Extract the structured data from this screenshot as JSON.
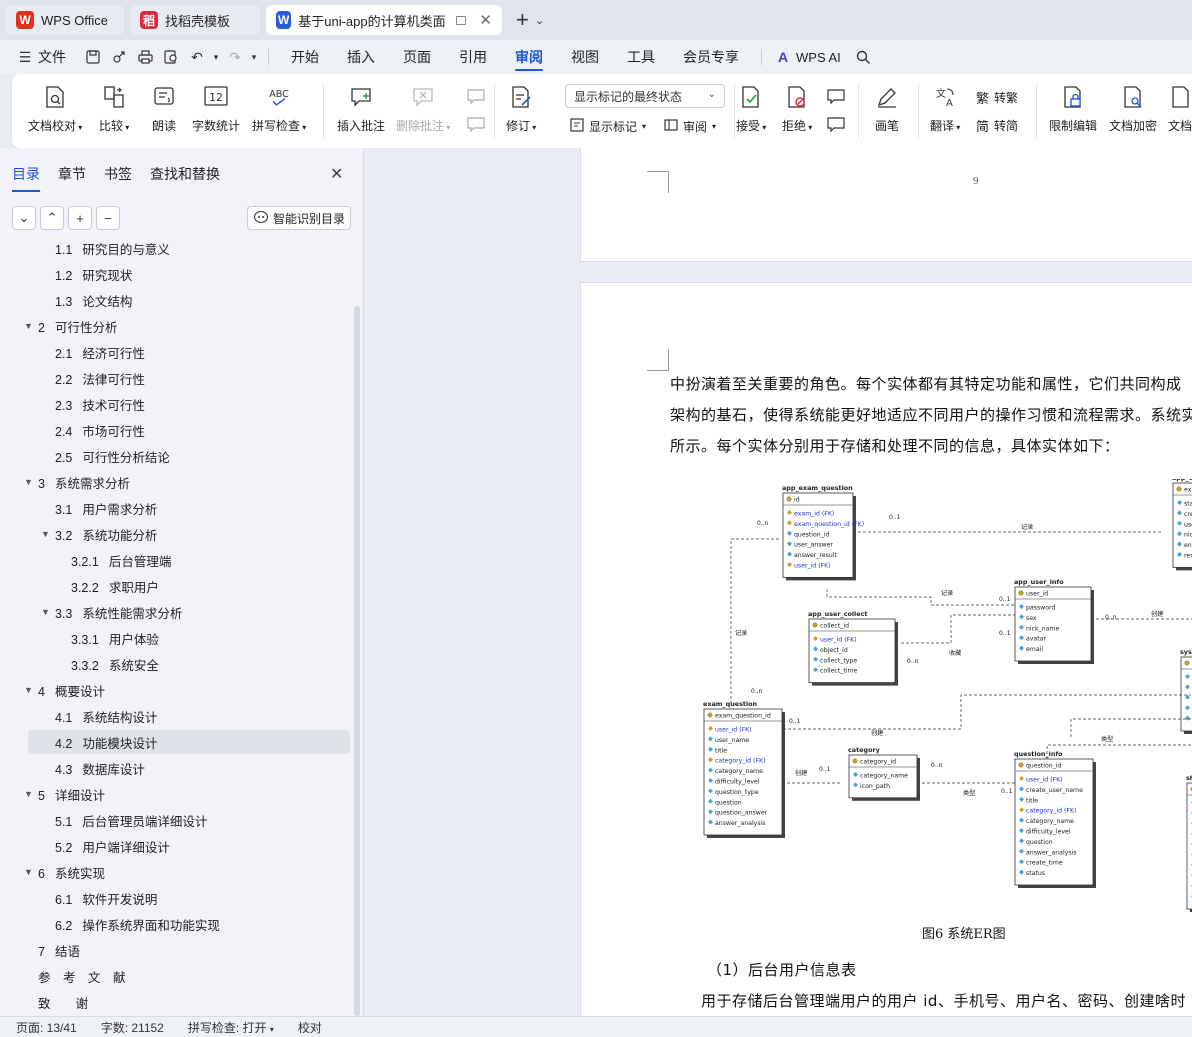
{
  "tabs": [
    {
      "label": "WPS Office",
      "icon": "wps-logo-icon"
    },
    {
      "label": "找稻壳模板",
      "icon": "docer-logo-icon"
    },
    {
      "label": "基于uni-app的计算机类面试王",
      "icon": "word-doc-icon"
    }
  ],
  "menu": {
    "file": "文件",
    "items": [
      "开始",
      "插入",
      "页面",
      "引用",
      "审阅",
      "视图",
      "工具",
      "会员专享"
    ],
    "active": "审阅",
    "wps_ai": "WPS AI"
  },
  "ribbon": {
    "doc_check": "文档校对",
    "compare": "比较",
    "read_aloud": "朗读",
    "word_count": "字数统计",
    "spell_check": "拼写检查",
    "insert_comment": "插入批注",
    "delete_comment": "删除批注",
    "revise": "修订",
    "markup_dropdown": "显示标记的最终状态",
    "show_markup": "显示标记",
    "review": "审阅",
    "accept": "接受",
    "reject": "拒绝",
    "brush": "画笔",
    "translate": "翻译",
    "to_traditional": "转繁",
    "to_simplified": "转简",
    "restrict_edit": "限制编辑",
    "doc_encrypt": "文档加密",
    "doc_more": "文档"
  },
  "panel": {
    "tabs": [
      "目录",
      "章节",
      "书签",
      "查找和替换"
    ],
    "active_tab": "目录",
    "smart_toc": "智能识别目录",
    "toc": [
      {
        "num": "1.1",
        "label": "研究目的与意义",
        "level": 2
      },
      {
        "num": "1.2",
        "label": "研究现状",
        "level": 2
      },
      {
        "num": "1.3",
        "label": "论文结构",
        "level": 2
      },
      {
        "num": "2",
        "label": "可行性分析",
        "level": 1
      },
      {
        "num": "2.1",
        "label": "经济可行性",
        "level": 2
      },
      {
        "num": "2.2",
        "label": "法律可行性",
        "level": 2
      },
      {
        "num": "2.3",
        "label": "技术可行性",
        "level": 2
      },
      {
        "num": "2.4",
        "label": "市场可行性",
        "level": 2
      },
      {
        "num": "2.5",
        "label": "可行性分析结论",
        "level": 2
      },
      {
        "num": "3",
        "label": "系统需求分析",
        "level": 1
      },
      {
        "num": "3.1",
        "label": "用户需求分析",
        "level": 2
      },
      {
        "num": "3.2",
        "label": "系统功能分析",
        "level": 2
      },
      {
        "num": "3.2.1",
        "label": "后台管理端",
        "level": 3
      },
      {
        "num": "3.2.2",
        "label": "求职用户",
        "level": 3
      },
      {
        "num": "3.3",
        "label": "系统性能需求分析",
        "level": 2
      },
      {
        "num": "3.3.1",
        "label": "用户体验",
        "level": 3
      },
      {
        "num": "3.3.2",
        "label": "系统安全",
        "level": 3
      },
      {
        "num": "4",
        "label": "概要设计",
        "level": 1
      },
      {
        "num": "4.1",
        "label": "系统结构设计",
        "level": 2
      },
      {
        "num": "4.2",
        "label": "功能模块设计",
        "level": 2
      },
      {
        "num": "4.3",
        "label": "数据库设计",
        "level": 2
      },
      {
        "num": "5",
        "label": "详细设计",
        "level": 1
      },
      {
        "num": "5.1",
        "label": "后台管理员端详细设计",
        "level": 2
      },
      {
        "num": "5.2",
        "label": "用户端详细设计",
        "level": 2
      },
      {
        "num": "6",
        "label": "系统实现",
        "level": 1
      },
      {
        "num": "6.1",
        "label": "软件开发说明",
        "level": 2
      },
      {
        "num": "6.2",
        "label": "操作系统界面和功能实现",
        "level": 2
      },
      {
        "num": "7",
        "label": "结语",
        "level": 1
      },
      {
        "num": "",
        "label": "参　考　文　献",
        "level": 0
      },
      {
        "num": "",
        "label": "致　　谢",
        "level": 0
      }
    ],
    "selected": "4.2"
  },
  "document": {
    "page_number": "9",
    "paragraph_lines": [
      "中扮演着至关重要的角色。每个实体都有其特定功能和属性，它们共同构成",
      "架构的基石，使得系统能更好地适应不同用户的操作习惯和流程需求。系统实",
      "所示。每个实体分别用于存储和处理不同的信息，具体实体如下："
    ],
    "caption": "图6 系统ER图",
    "section_title": "（1）后台用户信息表",
    "body_line": "用于存储后台管理端用户的用户 id、手机号、用户名、密码、创建啥时"
  },
  "er": {
    "entities": [
      {
        "name": "app_exam_question",
        "pk": "id",
        "fields": [
          "exam_id (FK)",
          "exam_question_id (FK)",
          "question_id",
          "user_answer",
          "answer_result",
          "user_id (FK)"
        ]
      },
      {
        "name": "app_user_info",
        "pk": "user_id",
        "fields": [
          "password",
          "sex",
          "nick_name",
          "avatar",
          "email"
        ]
      },
      {
        "name": "app_user_collect",
        "pk": "collect_id",
        "fields": [
          "user_id (FK)",
          "object_id",
          "collect_type",
          "collect_time"
        ]
      },
      {
        "name": "exam_question",
        "pk": "exam_question_id",
        "fields": [
          "user_id (FK)",
          "user_name",
          "title",
          "category_id (FK)",
          "category_name",
          "difficulty_level",
          "question_type",
          "question",
          "question_answer",
          "answer_analysis"
        ]
      },
      {
        "name": "category",
        "pk": "category_id",
        "fields": [
          "category_name",
          "icon_path"
        ]
      },
      {
        "name": "question_info",
        "pk": "question_id",
        "fields": [
          "user_id (FK)",
          "create_user_name",
          "title",
          "category_id (FK)",
          "category_name",
          "difficulty_level",
          "question",
          "answer_analysis",
          "create_time",
          "status"
        ]
      },
      {
        "name": "app_exam",
        "pk": "exam_",
        "fields": [
          "start_",
          "create",
          "user_",
          "nick_",
          "end_",
          "remar"
        ]
      },
      {
        "name": "sys_ad",
        "pk": "us",
        "fields": [
          "ph",
          "us",
          "pa",
          "po",
          "cr"
        ]
      },
      {
        "name": "share",
        "pk": "s",
        "fields": [
          "ti",
          "c",
          "c",
          "c",
          "c",
          "s",
          "u",
          "c",
          "r",
          "c"
        ]
      }
    ],
    "relations": [
      "记录",
      "记录",
      "记录",
      "收藏",
      "创建",
      "创建",
      "创建",
      "类型",
      "类型"
    ],
    "cardinalities": [
      "0..n",
      "0..1",
      "0..n",
      "0..1",
      "0..1",
      "0..n",
      "0..1",
      "0..n",
      "0..1",
      "0..n",
      "0..1"
    ]
  },
  "status": {
    "page": "页面: 13/41",
    "words": "字数: 21152",
    "spell": "拼写检查: 打开",
    "proof": "校对"
  },
  "colors": {
    "accent": "#1a56db",
    "wps_red": "#e0321f",
    "docer_red": "#d92b3a",
    "doc_blue": "#2b5bd7",
    "fk_blue": "#2233cc"
  }
}
